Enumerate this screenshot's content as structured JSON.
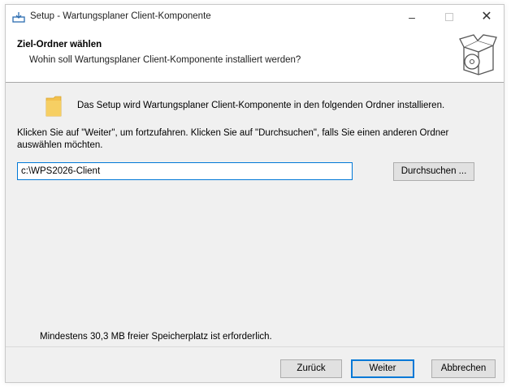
{
  "window": {
    "title": "Setup - Wartungsplaner Client-Komponente"
  },
  "controls": {
    "minimize": "–",
    "maximize": "☐",
    "close": "✕"
  },
  "header": {
    "title": "Ziel-Ordner wählen",
    "subtitle": "Wohin soll Wartungsplaner Client-Komponente installiert werden?"
  },
  "content": {
    "info": "Das Setup wird Wartungsplaner Client-Komponente in den folgenden Ordner installieren.",
    "instruction": "Klicken Sie auf \"Weiter\", um fortzufahren. Klicken Sie auf \"Durchsuchen\", falls Sie einen anderen Ordner auswählen möchten.",
    "path_value": "c:\\WPS2026-Client",
    "browse_label": "Durchsuchen ...",
    "space_required": "Mindestens 30,3 MB freier Speicherplatz ist erforderlich."
  },
  "footer": {
    "back_label": "Zurück",
    "next_label": "Weiter",
    "cancel_label": "Abbrechen"
  },
  "colors": {
    "accent": "#0078d7",
    "folder": "#f2c14e",
    "button_bg": "#e1e1e1"
  },
  "icons": {
    "app": "setup-installer-icon",
    "header": "software-box-icon",
    "folder": "folder-icon"
  }
}
